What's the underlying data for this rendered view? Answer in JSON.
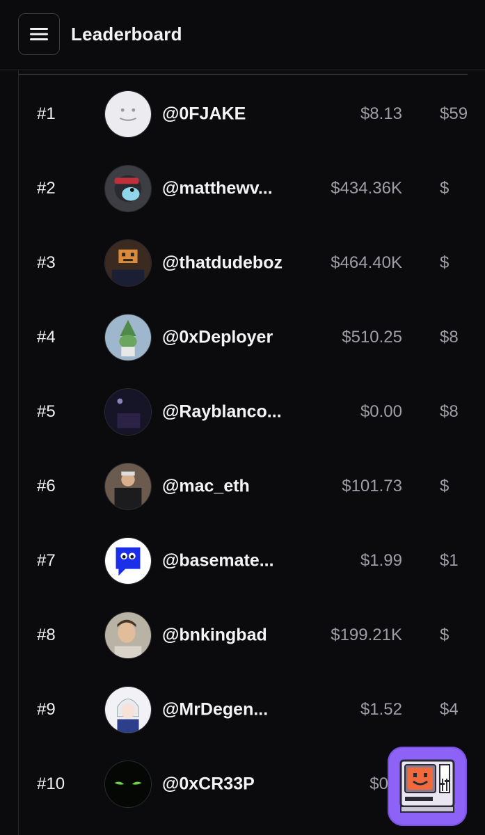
{
  "header": {
    "title": "Leaderboard",
    "menu_icon": "hamburger-menu-icon"
  },
  "leaderboard": {
    "rows": [
      {
        "rank": "#1",
        "handle": "@0FJAKE",
        "value": "$8.13",
        "value2": "$59",
        "avatar": "smiley-face-avatar"
      },
      {
        "rank": "#2",
        "handle": "@matthewv...",
        "value": "$434.36K",
        "value2": "$",
        "avatar": "cartoon-character-avatar"
      },
      {
        "rank": "#3",
        "handle": "@thatdudeboz",
        "value": "$464.40K",
        "value2": "$",
        "avatar": "pixel-robot-avatar"
      },
      {
        "rank": "#4",
        "handle": "@0xDeployer",
        "value": "$510.25",
        "value2": "$8",
        "avatar": "frog-wizard-avatar"
      },
      {
        "rank": "#5",
        "handle": "@Rayblanco...",
        "value": "$0.00",
        "value2": "$8",
        "avatar": "night-scene-avatar"
      },
      {
        "rank": "#6",
        "handle": "@mac_eth",
        "value": "$101.73",
        "value2": "$",
        "avatar": "person-photo-avatar"
      },
      {
        "rank": "#7",
        "handle": "@basemate...",
        "value": "$1.99",
        "value2": "$1",
        "avatar": "blue-chat-bubble-avatar"
      },
      {
        "rank": "#8",
        "handle": "@bnkingbad",
        "value": "$199.21K",
        "value2": "$",
        "avatar": "portrait-photo-avatar"
      },
      {
        "rank": "#9",
        "handle": "@MrDegen...",
        "value": "$1.52",
        "value2": "$4",
        "avatar": "anime-character-avatar"
      },
      {
        "rank": "#10",
        "handle": "@0xCR33P",
        "value": "$0.0",
        "value2": "",
        "avatar": "green-eyes-avatar"
      }
    ]
  },
  "fab": {
    "icon": "retro-computer-smiley-icon",
    "color": "#8d63f7"
  }
}
